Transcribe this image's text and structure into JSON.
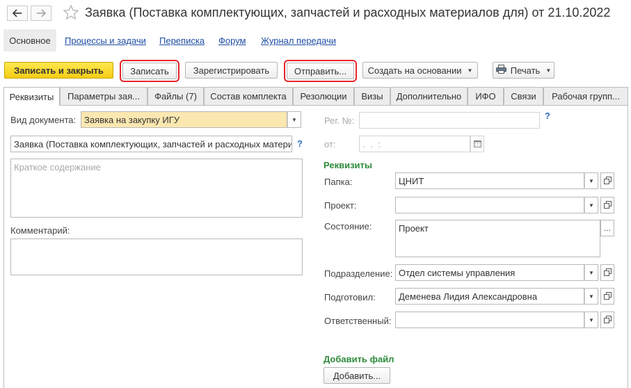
{
  "window": {
    "title": "Заявка (Поставка комплектующих, запчастей и расходных материалов для) от 21.10.2022"
  },
  "sections": {
    "main": "Основное",
    "links": [
      "Процессы и задачи",
      "Переписка",
      "Форум",
      "Журнал передачи"
    ]
  },
  "toolbar": {
    "save_close": "Записать и закрыть",
    "save": "Записать",
    "register": "Зарегистрировать",
    "send": "Отправить...",
    "create_based": "Создать на основании",
    "print": "Печать"
  },
  "tabs": [
    "Реквизиты",
    "Параметры зая...",
    "Файлы (7)",
    "Состав комплекта",
    "Резолюции",
    "Визы",
    "Дополнительно",
    "ИФО",
    "Связи",
    "Рабочая групп..."
  ],
  "left": {
    "doc_type_label": "Вид документа:",
    "doc_type_value": "Заявка на закупку ИГУ",
    "name_value": "Заявка (Поставка комплектующих, запчастей и расходных матери",
    "summary_placeholder": "Краткое содержание",
    "comment_label": "Комментарий:"
  },
  "right": {
    "reg_no_label": "Рег. №:",
    "from_label": "от:",
    "date_value": " .   .        :  ",
    "rekvizity_title": "Реквизиты",
    "folder_label": "Папка:",
    "folder_value": "ЦНИТ",
    "project_label": "Проект:",
    "project_value": "",
    "state_label": "Состояние:",
    "state_value": "Проект",
    "dept_label": "Подразделение:",
    "dept_value": "Отдел системы управления",
    "prepared_label": "Подготовил:",
    "prepared_value": "Деменева Лидия Александровна",
    "responsible_label": "Ответственный:",
    "responsible_value": "",
    "add_file_title": "Добавить файл",
    "add_button": "Добавить...",
    "help": "?",
    "ellipsis": "..."
  },
  "colors": {
    "primary_button": "#f5cc14",
    "highlight_outline": "#e8242a",
    "group_title": "#2e8b3a",
    "link": "#1f4ea3",
    "doc_type_bg": "#fbe7b0"
  }
}
